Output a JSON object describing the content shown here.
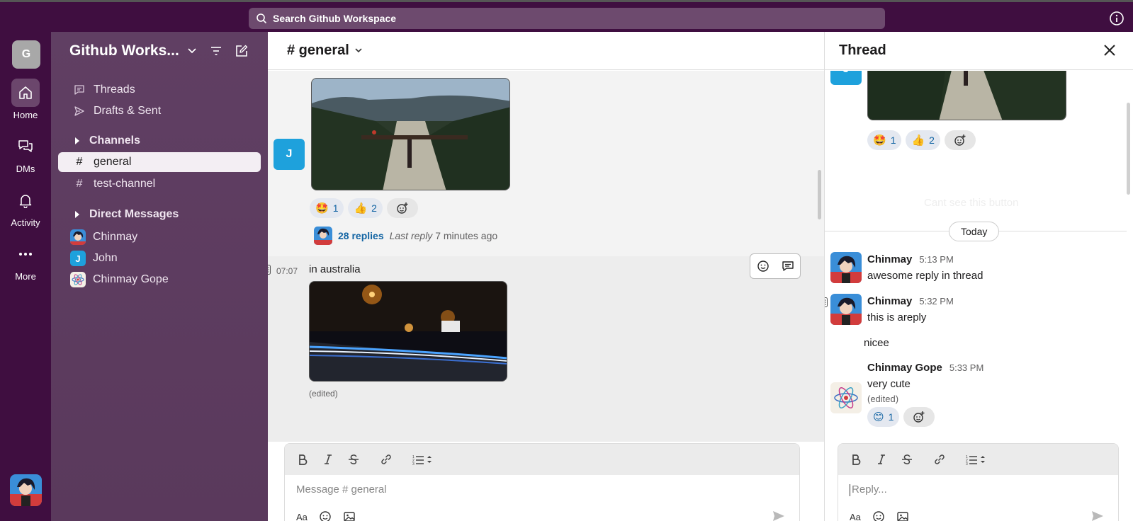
{
  "topbar": {
    "search_label": "Search Github Workspace"
  },
  "rail": {
    "workspace_initial": "G",
    "items": [
      {
        "label": "Home",
        "icon": "home-icon"
      },
      {
        "label": "DMs",
        "icon": "dms-icon"
      },
      {
        "label": "Activity",
        "icon": "bell-icon"
      },
      {
        "label": "More",
        "icon": "more-icon"
      }
    ]
  },
  "sidebar": {
    "workspace_name": "Github Works...",
    "nav": [
      {
        "label": "Threads",
        "icon": "threads-icon"
      },
      {
        "label": "Drafts & Sent",
        "icon": "send-icon"
      }
    ],
    "channels_title": "Channels",
    "channels": [
      {
        "prefix": "#",
        "label": "general"
      },
      {
        "prefix": "#",
        "label": "test-channel"
      }
    ],
    "dms_title": "Direct Messages",
    "dms": [
      {
        "label": "Chinmay"
      },
      {
        "label": "John",
        "initial": "J"
      },
      {
        "label": "Chinmay Gope"
      }
    ]
  },
  "channel": {
    "title": "# general",
    "messages": {
      "first": {
        "avatar_initial": "J",
        "reactions": [
          {
            "emoji": "🤩",
            "count": "1"
          },
          {
            "emoji": "👍",
            "count": "2"
          }
        ],
        "replies_count": "28 replies",
        "last_reply_label": "Last reply",
        "last_reply_ago": "7 minutes ago"
      },
      "second": {
        "time": "07:07",
        "text": "in australia",
        "edited": "(edited)"
      }
    },
    "composer": {
      "placeholder": "Message # general",
      "format_label": "Aa"
    }
  },
  "thread": {
    "title": "Thread",
    "top_avatar_initial": "J",
    "top_reactions": [
      {
        "emoji": "🤩",
        "count": "1"
      },
      {
        "emoji": "👍",
        "count": "2"
      }
    ],
    "hidden_button_text": "Cant see this button",
    "divider_label": "Today",
    "replies": [
      {
        "author": "Chinmay",
        "time": "5:13 PM",
        "text": "awesome reply in thread"
      },
      {
        "author": "Chinmay",
        "time": "5:32 PM",
        "text": "this is areply",
        "followup": "nicee"
      },
      {
        "author": "Chinmay Gope",
        "time": "5:33 PM",
        "text": "very cute",
        "edited": "(edited)",
        "reaction": {
          "emoji": "😊",
          "count": "1"
        }
      }
    ],
    "composer": {
      "placeholder": "Reply...",
      "format_label": "Aa"
    }
  },
  "colors": {
    "rail_bg": "#3f0e40",
    "sidebar_bg": "#603f63",
    "link": "#1264a3",
    "avatar_blue": "#1ea1dc"
  }
}
